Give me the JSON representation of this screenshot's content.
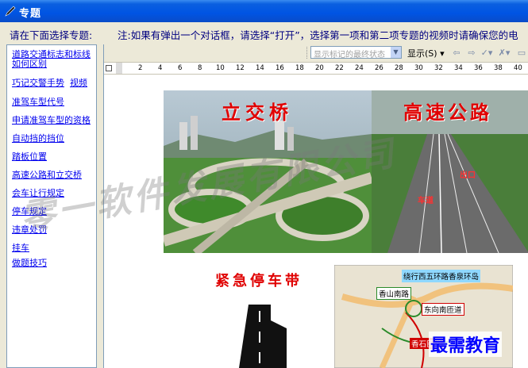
{
  "window": {
    "title": "专题"
  },
  "prompt": {
    "left": "请在下面选择专题:",
    "note": "注:如果有弹出一个对话框，请选择“打开”，选择第一项和第二项专题的视频时请确保您的电"
  },
  "topics": [
    {
      "label": "道路交通标志和标线如何区别"
    },
    {
      "label": "巧记交警手势",
      "extra": "视频"
    },
    {
      "label": "准驾车型代号"
    },
    {
      "label": "申请准驾车型的资格"
    },
    {
      "label": "自动挡的挡位"
    },
    {
      "label": "踏板位置"
    },
    {
      "label": "高速公路和立交桥"
    },
    {
      "label": "会车让行规定"
    },
    {
      "label": "停车规定"
    },
    {
      "label": "违章处罚"
    },
    {
      "label": "挂车"
    },
    {
      "label": "做题技巧"
    }
  ],
  "toolbar": {
    "markup_dropdown": "显示标记的最终状态",
    "show_label": "显示(S)"
  },
  "ruler": {
    "ticks": [
      "2",
      "4",
      "6",
      "8",
      "10",
      "12",
      "14",
      "16",
      "18",
      "20",
      "22",
      "24",
      "26",
      "28",
      "30",
      "32",
      "34",
      "36",
      "38",
      "40"
    ]
  },
  "document": {
    "photo1_caption": "立交桥",
    "photo2_caption": "高速公路",
    "photo2_label1": "出口",
    "photo2_label2": "车道",
    "heading2": "紧急停车带",
    "map_labels": [
      "绕行西五环路香泉环岛",
      "香山南路",
      "东向南匝道",
      "香石匝道"
    ]
  },
  "watermark": "零一软件发展有限公司",
  "brand": "最需教育",
  "colors": {
    "titlebar": "#0054e3",
    "link": "#0000ee",
    "caption_red": "#e00000"
  }
}
